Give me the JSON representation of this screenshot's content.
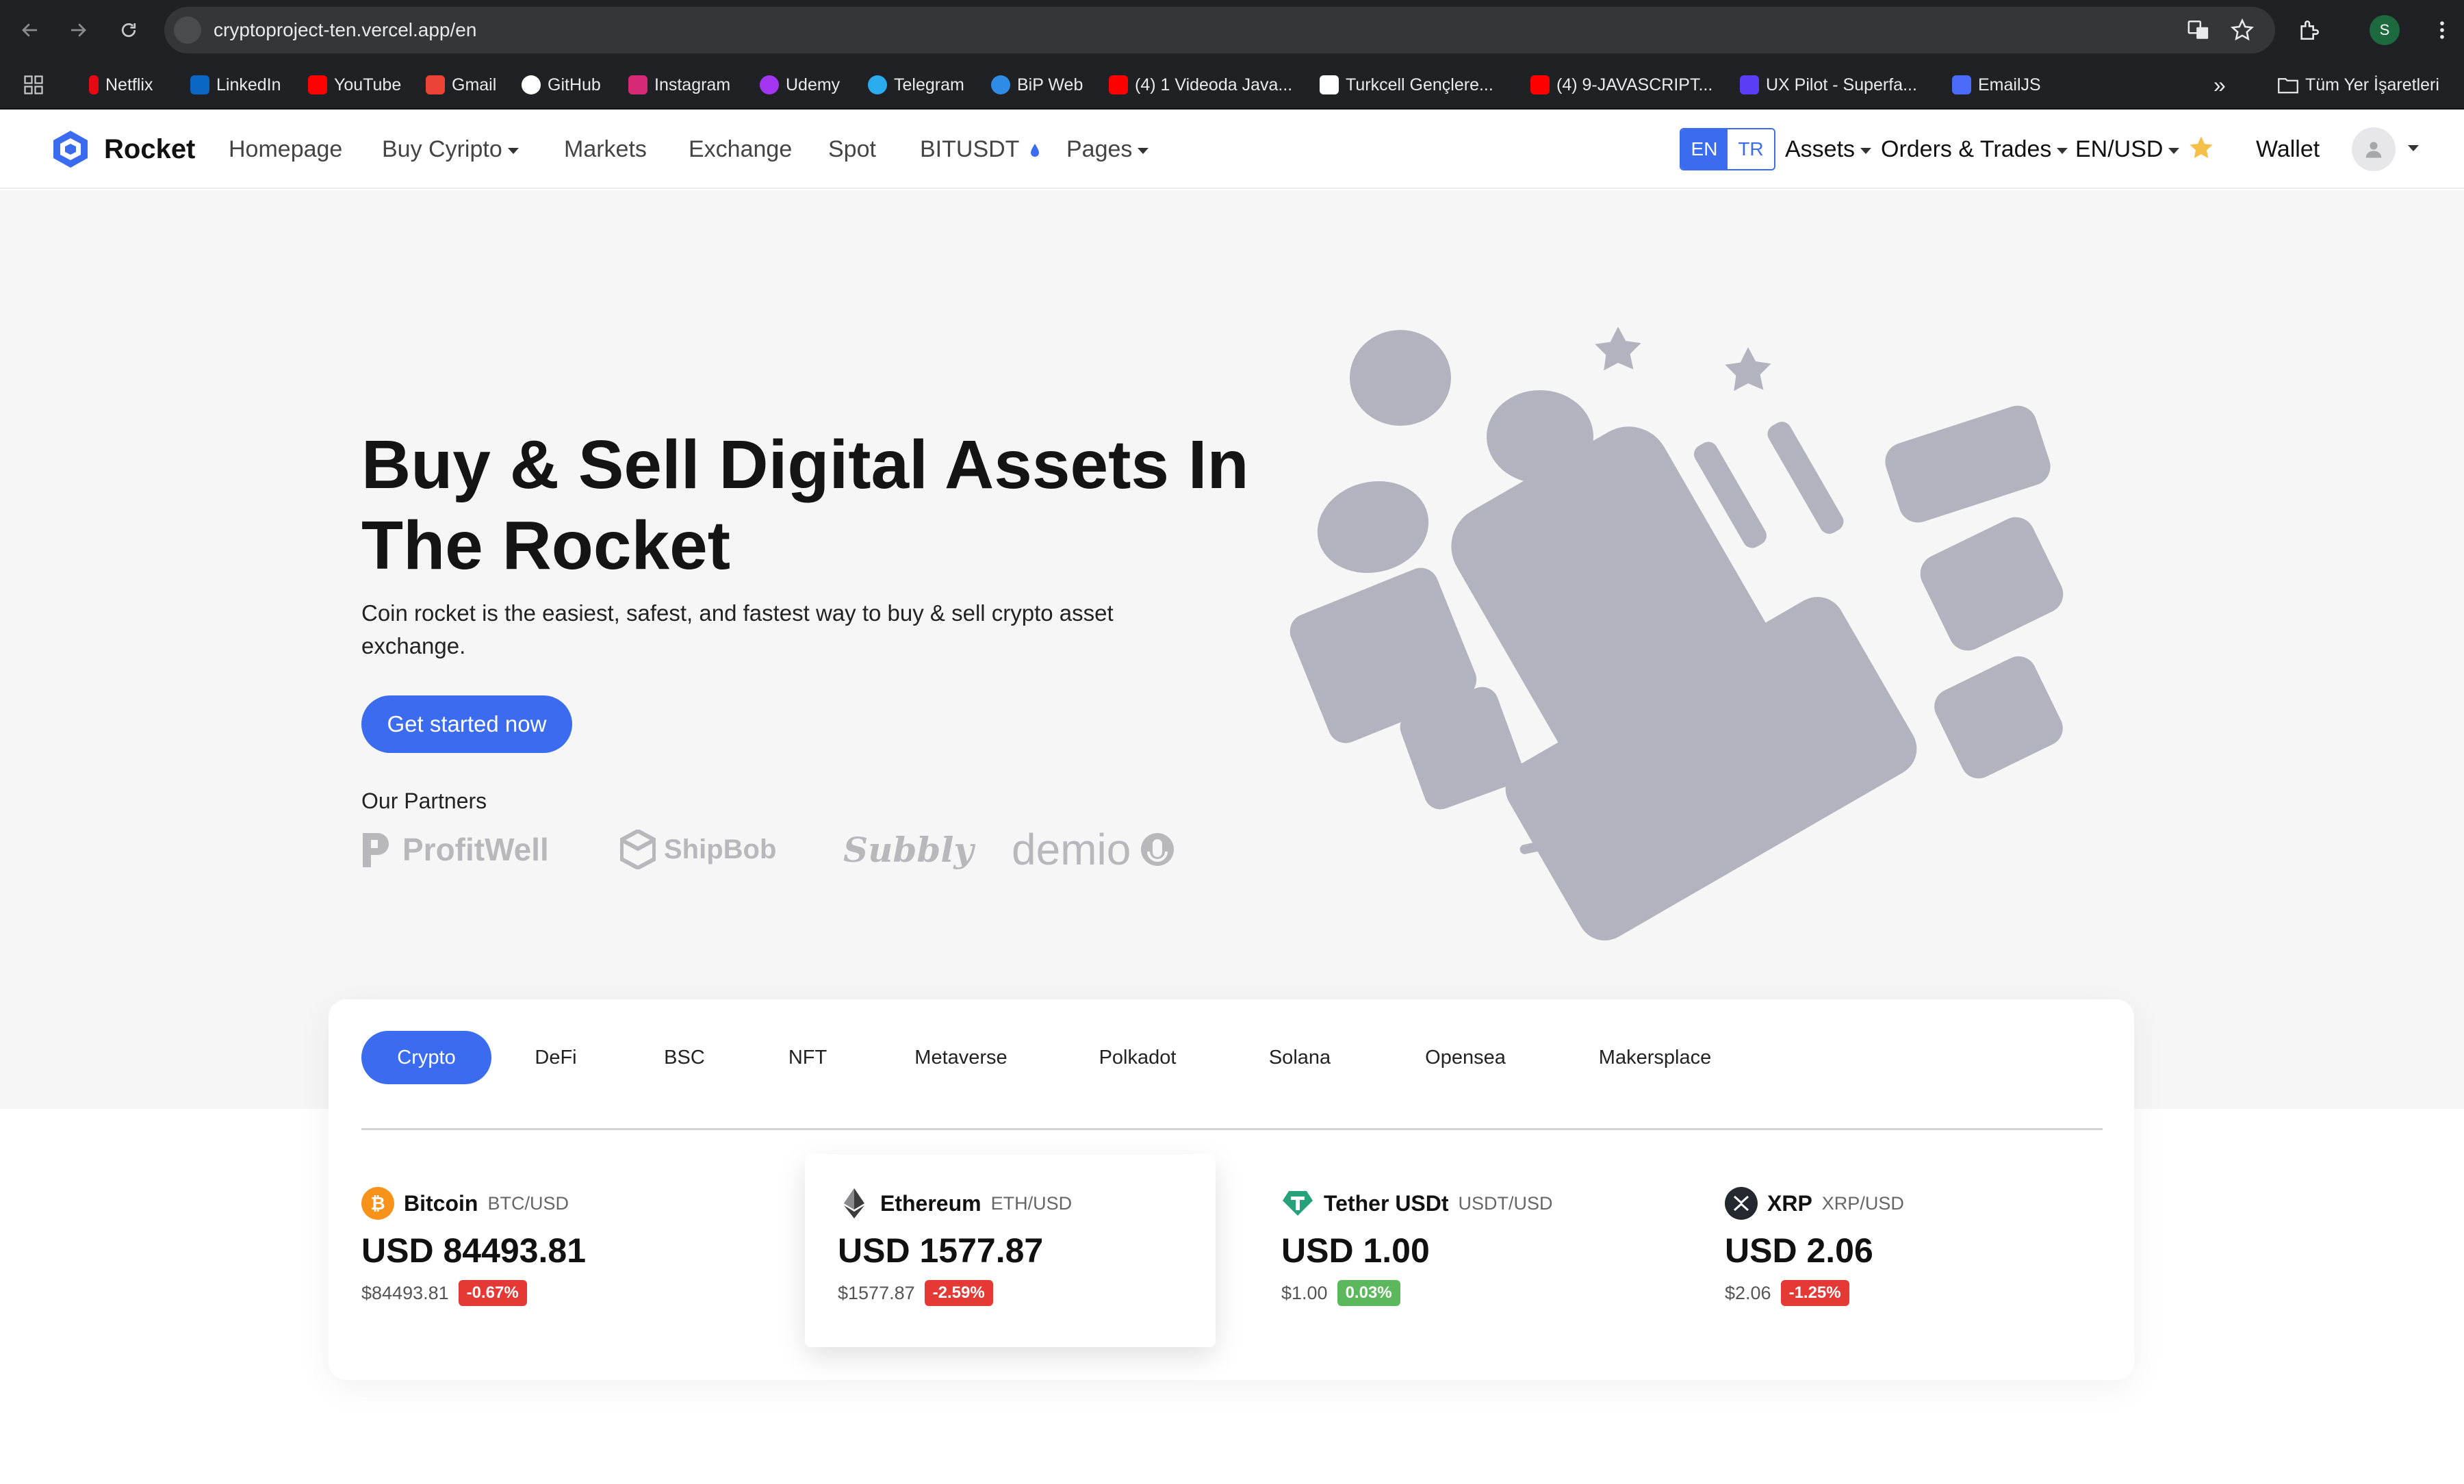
{
  "browser": {
    "url": "cryptoproject-ten.vercel.app/en",
    "profile_initial": "S",
    "bookmarks": [
      {
        "label": "Netflix",
        "color": "#e50914"
      },
      {
        "label": "LinkedIn",
        "color": "#0a66c2"
      },
      {
        "label": "YouTube",
        "color": "#ff0000"
      },
      {
        "label": "Gmail",
        "color": "#ea4335"
      },
      {
        "label": "GitHub",
        "color": "#ffffff"
      },
      {
        "label": "Instagram",
        "color": "#d62976"
      },
      {
        "label": "Udemy",
        "color": "#a435f0"
      },
      {
        "label": "Telegram",
        "color": "#2aabee"
      },
      {
        "label": "BiP Web",
        "color": "#2e8be6"
      },
      {
        "label": "(4) 1 Videoda Java...",
        "color": "#ff0000"
      },
      {
        "label": "Turkcell Gençlere...",
        "color": "#ffffff"
      },
      {
        "label": "(4) 9-JAVASCRIPT...",
        "color": "#ff0000"
      },
      {
        "label": "UX Pilot - Superfa...",
        "color": "#5b3df5"
      },
      {
        "label": "EmailJS",
        "color": "#4b6bfb"
      }
    ],
    "more_bookmarks": "»",
    "all_bookmarks": "Tüm Yer İşaretleri"
  },
  "site": {
    "brand": "Rocket",
    "nav": {
      "homepage": "Homepage",
      "buy_crypto": "Buy Cyripto",
      "markets": "Markets",
      "exchange": "Exchange",
      "spot": "Spot",
      "bitusdt": "BITUSDT",
      "pages": "Pages"
    },
    "lang": {
      "en": "EN",
      "tr": "TR"
    },
    "assets": "Assets",
    "orders": "Orders & Trades",
    "currency": "EN/USD",
    "wallet": "Wallet",
    "accent_color": "#3b6cf0"
  },
  "hero": {
    "title_line1": "Buy & Sell Digital Assets In",
    "title_line2": "The Rocket",
    "subtitle": "Coin rocket is the easiest, safest, and fastest way to buy & sell crypto asset exchange.",
    "cta": "Get started now",
    "partners_label": "Our Partners",
    "partners": [
      "ProfitWell",
      "ShipBob",
      "Subbly",
      "demio"
    ]
  },
  "market": {
    "tabs": [
      "Crypto",
      "DeFi",
      "BSC",
      "NFT",
      "Metaverse",
      "Polkadot",
      "Solana",
      "Opensea",
      "Makersplace"
    ],
    "active_tab": "Crypto",
    "coins": [
      {
        "name": "Bitcoin",
        "pair": "BTC/USD",
        "price": "USD 84493.81",
        "usd": "$84493.81",
        "change": "-0.67%",
        "trend": "down",
        "icon": "bitcoin-icon",
        "icon_color": "#f7931a"
      },
      {
        "name": "Ethereum",
        "pair": "ETH/USD",
        "price": "USD 1577.87",
        "usd": "$1577.87",
        "change": "-2.59%",
        "trend": "down",
        "icon": "ethereum-icon",
        "icon_color": "#3c3c3d"
      },
      {
        "name": "Tether USDt",
        "pair": "USDT/USD",
        "price": "USD 1.00",
        "usd": "$1.00",
        "change": "0.03%",
        "trend": "up",
        "icon": "tether-icon",
        "icon_color": "#26a17b"
      },
      {
        "name": "XRP",
        "pair": "XRP/USD",
        "price": "USD 2.06",
        "usd": "$2.06",
        "change": "-1.25%",
        "trend": "down",
        "icon": "xrp-icon",
        "icon_color": "#23292f"
      }
    ],
    "down_color": "#e53935",
    "up_color": "#5cb85c"
  }
}
